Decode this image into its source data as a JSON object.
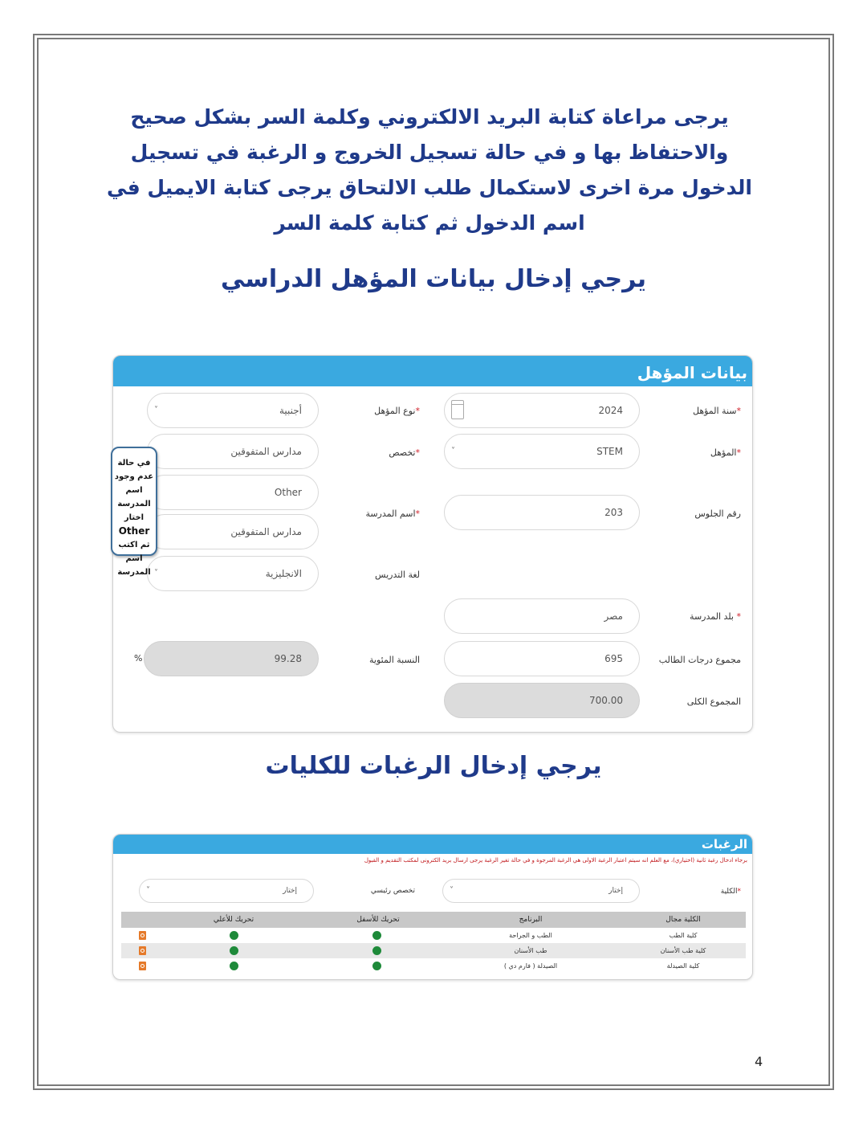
{
  "intro_text": "يرجى مراعاة كتابة البريد الالكتروني وكلمة السر بشكل صحيح والاحتفاظ بها و في حالة تسجيل الخروج و الرغبة في تسجيل الدخول مرة اخرى لاستكمال طلب الالتحاق يرجى كتابة الايميل في اسم الدخول ثم كتابة كلمة السر",
  "headings": {
    "qualification": "يرجي إدخال بيانات المؤهل الدراسي",
    "desires": "يرجي إدخال الرغبات للكليات"
  },
  "qualification_panel": {
    "title": "بيانات المؤهل",
    "required_mark": "*",
    "fields": {
      "qualification_year": {
        "label": "سنة المؤهل",
        "value": "2024",
        "icon": "calendar-icon"
      },
      "qualification_type": {
        "label": "نوع المؤهل",
        "value": "أجنبية",
        "icon": "chevron-down-icon"
      },
      "qualification": {
        "label": "المؤهل",
        "value": "STEM",
        "icon": "chevron-down-icon"
      },
      "specialization": {
        "label": "تخصص",
        "value": "مدارس المتفوقين"
      },
      "seat_number": {
        "label": "رقم الجلوس",
        "value": "203"
      },
      "school_name": {
        "label": "اسم المدرسة",
        "value": "Other",
        "extra_value": "مدارس المتفوقين"
      },
      "teaching_language": {
        "label": "لغة التدريس",
        "value": "الانجليزية",
        "icon": "chevron-down-icon"
      },
      "school_country": {
        "label": "بلد المدرسة",
        "value": "مصر"
      },
      "student_total": {
        "label": "مجموع درجات الطالب",
        "value": "695"
      },
      "percentage": {
        "label": "النسبة المئوية",
        "value": "99.28",
        "suffix": "%"
      },
      "grand_total": {
        "label": "المجموع الكلى",
        "value": "700.00"
      }
    },
    "callout": {
      "line1": "في حالة عدم وجود اسم المدرسة اختار",
      "line2": "Other",
      "line3": "ثم اكتب اسم المدرسة"
    }
  },
  "desires_panel": {
    "title": "الرغبات",
    "notice": "برجاء ادخال رغبة ثانية (اختياري)، مع العلم انه سيتم اعتبار الرغبة الاولى هي الرغبة المرجوة و في حالة تغير الرغبة يرجى ارسال بريد الكترونى لمكتب التقديم و القبول",
    "college_label": "الكلية",
    "college_value": "إختار",
    "major_label": "تخصص رئيسي",
    "major_value": "إختار",
    "columns": [
      "الكلية مجال",
      "البرنامج",
      "تحريك للأسفل",
      "تحريك للأعلي"
    ],
    "rows": [
      {
        "college": "كلية الطب",
        "program": "الطب و الجراحة"
      },
      {
        "college": "كلية طب الأسنان",
        "program": "طب الأسنان"
      },
      {
        "college": "كلية الصيدلة",
        "program": "الصيدلة ( فارم دي )"
      }
    ]
  },
  "page_number": "4",
  "colors": {
    "header_blue": "#3aa9e0",
    "heading_navy": "#1f3a8a",
    "required_red": "#d0212b",
    "move_green": "#1e8a3a",
    "delete_orange": "#e57a2a"
  }
}
